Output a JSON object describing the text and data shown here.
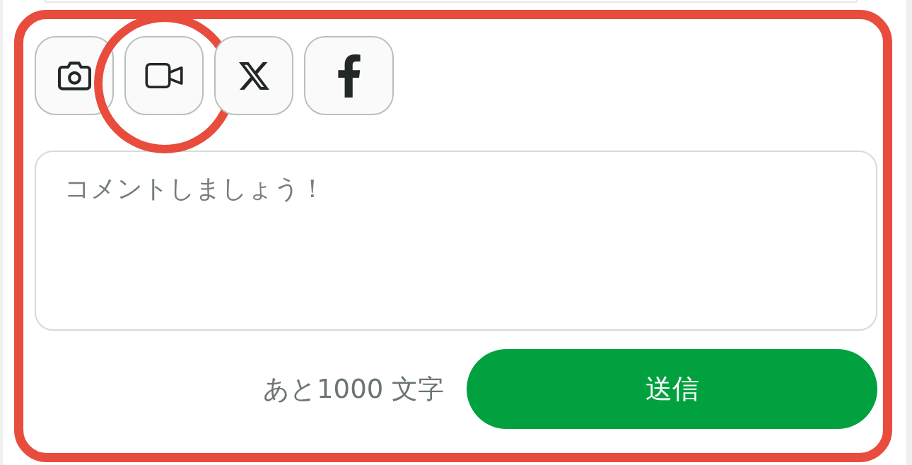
{
  "attachment_buttons": [
    {
      "kind": "camera",
      "highlighted": false
    },
    {
      "kind": "video",
      "highlighted": true
    },
    {
      "kind": "x",
      "highlighted": false
    },
    {
      "kind": "facebook",
      "highlighted": false
    }
  ],
  "composer": {
    "highlighted": true,
    "comment_box": {
      "placeholder": "コメントしましょう！"
    },
    "remaining": "あと1000 文字",
    "send_button": "送信"
  }
}
